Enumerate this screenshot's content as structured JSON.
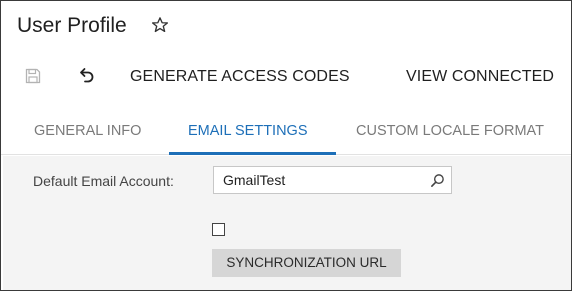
{
  "header": {
    "title": "User Profile",
    "favorite_icon": "star-outline-icon"
  },
  "toolbar": {
    "save_icon": "floppy-disk-icon",
    "undo_icon": "undo-arrow-icon",
    "buttons": [
      {
        "label": "GENERATE ACCESS CODES"
      },
      {
        "label": "VIEW CONNECTED"
      }
    ]
  },
  "tabs": [
    {
      "label": "GENERAL INFO",
      "active": false
    },
    {
      "label": "EMAIL SETTINGS",
      "active": true
    },
    {
      "label": "CUSTOM LOCALE FORMAT",
      "active": false
    }
  ],
  "email_settings": {
    "default_account_label": "Default Email Account:",
    "default_account_value": "GmailTest",
    "checkbox_checked": false,
    "sync_button_label": "SYNCHRONIZATION URL"
  },
  "colors": {
    "accent": "#1d6fb8",
    "content_bg": "#f4f4f4",
    "button_bg": "#d6d6d6"
  }
}
